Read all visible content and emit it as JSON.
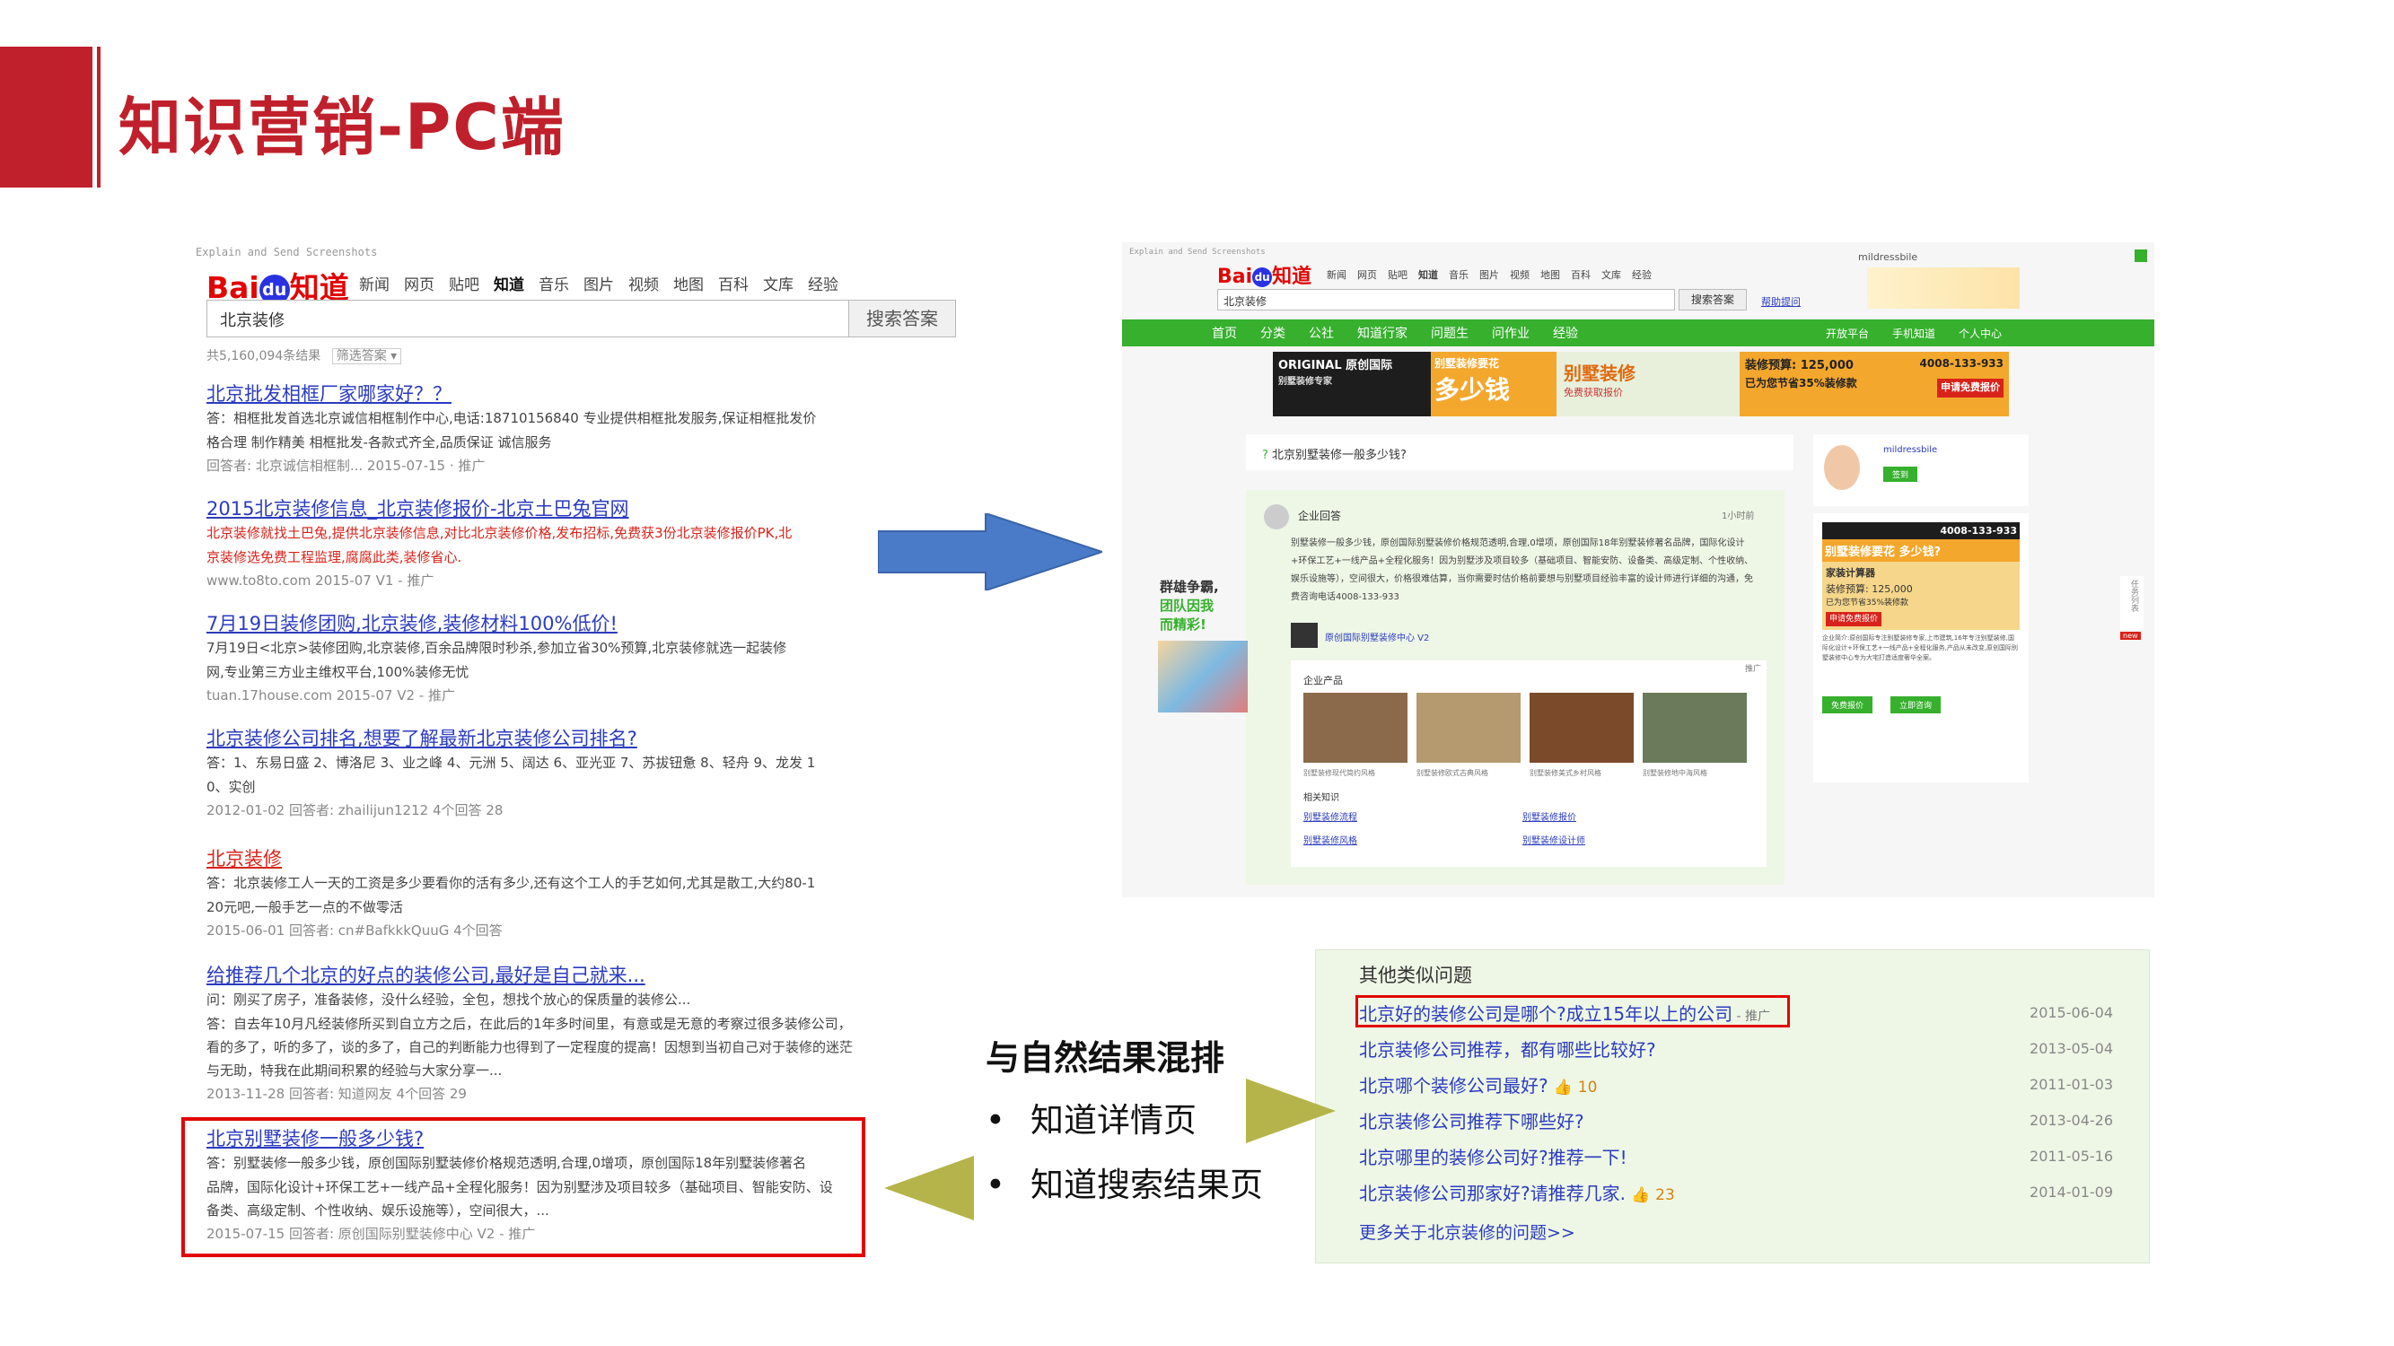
{
  "slide": {
    "title": "知识营销-PC端",
    "accent_color": "#c0202b"
  },
  "left_screenshot": {
    "watermark": "Explain and Send Screenshots",
    "logo_bai": "Bai",
    "logo_du": "du",
    "logo_zhidao": "知道",
    "nav": [
      "新闻",
      "网页",
      "贴吧",
      "知道",
      "音乐",
      "图片",
      "视频",
      "地图",
      "百科",
      "文库",
      "经验"
    ],
    "search_value": "北京装修",
    "search_button": "搜索答案",
    "result_count": "共5,160,094条结果",
    "filter": "筛选答案",
    "results": [
      {
        "title": "北京批发相框厂家哪家好？？",
        "body1": "答：相框批发首选北京诚信相框制作中心,电话:18710156840 专业提供相框批发服务,保证相框批发价",
        "body2": "格合理 制作精美 相框批发-各款式齐全,品质保证 诚信服务",
        "meta": "回答者: 北京诚信相框制... 2015-07-15 · 推广"
      },
      {
        "title": "2015北京装修信息_北京装修报价-北京土巴兔官网",
        "body1": "北京装修就找土巴兔,提供北京装修信息,对比北京装修价格,发布招标,免费获3份北京装修报价PK,北",
        "body2": "京装修选免费工程监理,腐腐此类,装修省心.",
        "meta": "www.to8to.com 2015-07 V1 - 推广"
      },
      {
        "title": "7月19日装修团购,北京装修,装修材料100%低价!",
        "body1": "7月19日<北京>装修团购,北京装修,百余品牌限时秒杀,参加立省30%预算,北京装修就选一起装修",
        "body2": "网,专业第三方业主维权平台,100%装修无忧",
        "meta": "tuan.17house.com 2015-07 V2 - 推广"
      },
      {
        "title": "北京装修公司排名,想要了解最新北京装修公司排名?",
        "body1": "答：1、东易日盛 2、博洛尼 3、业之峰 4、元洲 5、阔达 6、亚光亚 7、苏拔钮惫 8、轻舟 9、龙发 1",
        "body2": "0、实创",
        "meta": "2012-01-02 回答者: zhailijun1212 4个回答 28"
      },
      {
        "title": "北京装修",
        "body1": "答：北京装修工人一天的工资是多少要看你的活有多少,还有这个工人的手艺如何,尤其是散工,大约80-1",
        "body2": "20元吧,一般手艺一点的不做零活",
        "meta": "2015-06-01 回答者: cn#BafkkkQuuG 4个回答"
      },
      {
        "title": "给推荐几个北京的好点的装修公司,最好是自己就来...",
        "body1": "问：刚买了房子，准备装修，没什么经验，全包，想找个放心的保质量的装修公...",
        "body2": "答：自去年10月凡经装修所买到自立方之后，在此后的1年多时间里，有意或是无意的考察过很多装修公司，看的多了，听的多了，谈的多了，自己的判断能力也得到了一定程度的提高！因想到当初自己对于装修的迷茫与无助，特我在此期间积累的经验与大家分享一...",
        "meta": "2013-11-28 回答者: 知道网友 4个回答 29"
      },
      {
        "title": "北京别墅装修一般多少钱?",
        "body1": "答：别墅装修一般多少钱，原创国际别墅装修价格规范透明,合理,0增项，原创国际18年别墅装修著名",
        "body2": "品牌，国际化设计+环保工艺+一线产品+全程化服务！因为别墅涉及项目较多（基础项目、智能安防、设备类、高级定制、个性收纳、娱乐设施等），空间很大，...",
        "meta": "2015-07-15 回答者: 原创国际别墅装修中心 V2 - 推广"
      }
    ]
  },
  "right_screenshot": {
    "watermark": "Explain and Send Screenshots",
    "logo_bai": "Bai",
    "logo_du": "du",
    "logo_zhidao": "知道",
    "nav": [
      "新闻",
      "网页",
      "贴吧",
      "知道",
      "音乐",
      "图片",
      "视频",
      "地图",
      "百科",
      "文库",
      "经验"
    ],
    "search_value": "北京装修",
    "search_button": "搜索答案",
    "help_link": "帮助提问",
    "user_top": "mildressbile",
    "green_nav": [
      "首页",
      "分类",
      "公社",
      "知道行家",
      "问题生",
      "问作业",
      "经验"
    ],
    "green_nav_right": [
      "开放平台",
      "手机知道",
      "个人中心"
    ],
    "banner": {
      "brand": "ORIGINAL 原创国际",
      "brand_sub": "别墅装修专家",
      "slogan": "别墅装修要花",
      "big": "多少钱",
      "villa": "别墅装修",
      "villa_sub": "免费获取报价",
      "budget": "装修预算: 125,000",
      "save": "已为您节省35%装修款",
      "phone": "4008-133-933",
      "quote": "申请免费报价"
    },
    "question": "北京别墅装修一般多少钱?",
    "answer_label": "企业回答",
    "answer_time": "1小时前",
    "answer_text": "别墅装修一般多少钱，原创国际别墅装修价格规范透明,合理,0增项，原创国际18年别墅装修著名品牌，国际化设计+环保工艺+一线产品+全程化服务！因为别墅涉及项目较多（基础项目、智能安防、设备类、高级定制、个性收纳、娱乐设施等），空间很大，价格很难估算，当你需要时估价格前要想与别墅项目经验丰富的设计师进行详细的沟通，免费咨询电话4008-133-933",
    "company": "原创国际别墅装修中心 V2",
    "promo": "推广",
    "products_label": "企业产品",
    "products": [
      "别墅装修现代简约风格",
      "别墅装修欧式古典风格",
      "别墅装修美式乡村风格",
      "别墅装修地中海风格"
    ],
    "related_label": "相关知识",
    "related": [
      "别墅装修流程",
      "别墅装修报价",
      "别墅装修风格",
      "别墅装修设计师"
    ],
    "left_ad_line1": "群雄争霸,",
    "left_ad_line2": "团队因我",
    "left_ad_line3": "而精彩!",
    "side_user": "mildressbile",
    "side_signin": "签到",
    "side_ad": {
      "phone": "4008-133-933",
      "headline": "别墅装修要花 多少钱?",
      "calc": "家装计算器",
      "budget": "装修预算: 125,000",
      "save": "已为您节省35%装修款",
      "apply": "申请免费报价",
      "desc": "企业简介:原创国际专注别墅装修专家,上市建筑,16年专注别墅装修,国际化设计+环保工艺+一线产品+全程化服务,产品从未改变,原创国际别墅装修中心专为大宅打造适度奢华全案。",
      "btn1": "免费报价",
      "btn2": "立即咨询"
    },
    "side_tab": "任务列表",
    "side_new": "new"
  },
  "similar": {
    "title": "其他类似问题",
    "rows": [
      {
        "q": "北京好的装修公司是哪个?成立15年以上的公司",
        "tag": " - 推广",
        "thumb": "",
        "date": "2015-06-04"
      },
      {
        "q": "北京装修公司推荐，都有哪些比较好?",
        "tag": "",
        "thumb": "",
        "date": "2013-05-04"
      },
      {
        "q": "北京哪个装修公司最好?",
        "tag": "",
        "thumb": "10",
        "date": "2011-01-03"
      },
      {
        "q": "北京装修公司推荐下哪些好?",
        "tag": "",
        "thumb": "",
        "date": "2013-04-26"
      },
      {
        "q": "北京哪里的装修公司好?推荐一下!",
        "tag": "",
        "thumb": "",
        "date": "2011-05-16"
      },
      {
        "q": "北京装修公司那家好?请推荐几家.",
        "tag": "",
        "thumb": "23",
        "date": "2014-01-09"
      }
    ],
    "more": "更多关于北京装修的问题>>"
  },
  "middle": {
    "heading": "与自然结果混排",
    "bullets": [
      "知道详情页",
      "知道搜索结果页"
    ]
  },
  "colors": {
    "baidu_red": "#e10602",
    "baidu_blue": "#2932e1",
    "arrow_blue": "#4a7bc8",
    "arrow_olive": "#b4b44a",
    "zhidao_green": "#36b02d",
    "ad_orange": "#f3a72d"
  }
}
